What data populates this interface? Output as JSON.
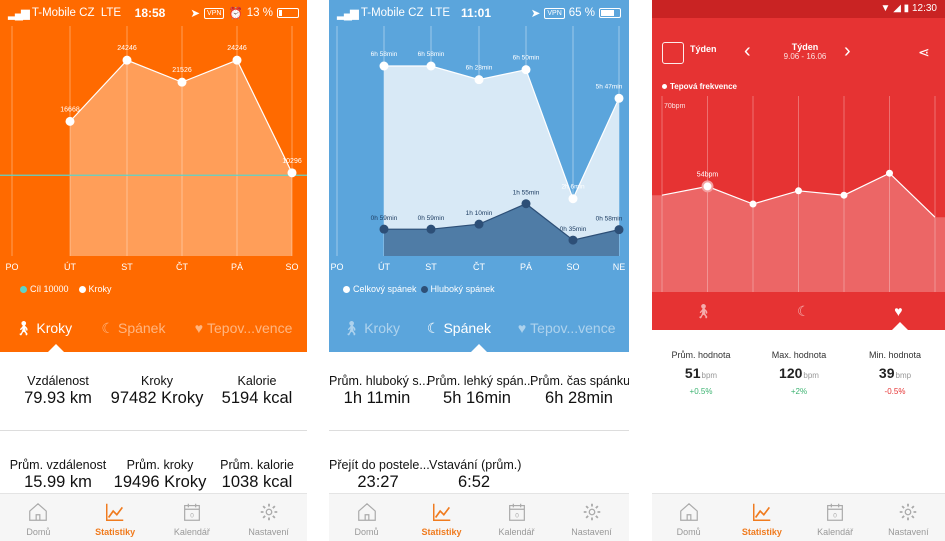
{
  "colors": {
    "orange": "#ff6a00",
    "blue": "#5ba5dc",
    "red": "#e63333",
    "nav_active": "#f07b1e"
  },
  "panel1": {
    "status": {
      "signal": "T-Mobile CZ",
      "net": "LTE",
      "time": "18:58",
      "vpn": "VPN",
      "battery": "13 %",
      "battery_level": 0.13
    },
    "x_labels": [
      "PO",
      "ÚT",
      "ST",
      "ČT",
      "PÁ",
      "SO"
    ],
    "points": [
      {
        "label": "16668",
        "value": 16668
      },
      {
        "label": "24246",
        "value": 24246
      },
      {
        "label": "21526",
        "value": 21526
      },
      {
        "label": "24246",
        "value": 24246
      },
      {
        "label": "10296",
        "value": 10296
      }
    ],
    "goal": 10000,
    "legend": {
      "goal": "Cíl 10000",
      "steps": "Kroky"
    },
    "tabs": {
      "steps": "Kroky",
      "sleep": "Spánek",
      "heart": "Tepov...vence"
    },
    "stats": [
      {
        "label": "Vzdálenost",
        "value": "79.93 km"
      },
      {
        "label": "Kroky",
        "value": "97482 Kroky"
      },
      {
        "label": "Kalorie",
        "value": "5194 kcal"
      },
      {
        "label": "Prům. vzdálenost",
        "value": "15.99 km"
      },
      {
        "label": "Prům. kroky",
        "value": "19496 Kroky"
      },
      {
        "label": "Prům. kalorie",
        "value": "1038 kcal"
      }
    ],
    "nav": [
      "Domů",
      "Statistiky",
      "Kalendář",
      "Nastavení"
    ]
  },
  "panel2": {
    "status": {
      "signal": "T-Mobile CZ",
      "net": "LTE",
      "time": "11:01",
      "vpn": "VPN",
      "battery": "65 %",
      "battery_level": 0.65
    },
    "x_labels": [
      "PO",
      "ÚT",
      "ST",
      "ČT",
      "PÁ",
      "SO",
      "NE"
    ],
    "total": [
      {
        "label": "6h 58min",
        "minutes": 418
      },
      {
        "label": "6h 58min",
        "minutes": 418
      },
      {
        "label": "6h 28min",
        "minutes": 388
      },
      {
        "label": "6h 50min",
        "minutes": 410
      },
      {
        "label": "2h 6min",
        "minutes": 126
      },
      {
        "label": "5h 47min",
        "minutes": 347
      }
    ],
    "deep": [
      {
        "label": "0h 59min",
        "minutes": 59
      },
      {
        "label": "0h 59min",
        "minutes": 59
      },
      {
        "label": "1h 10min",
        "minutes": 70
      },
      {
        "label": "1h 55min",
        "minutes": 115
      },
      {
        "label": "0h 35min",
        "minutes": 35
      },
      {
        "label": "0h 58min",
        "minutes": 58
      }
    ],
    "legend": {
      "total": "Celkový spánek",
      "deep": "Hluboký spánek"
    },
    "tabs": {
      "steps": "Kroky",
      "sleep": "Spánek",
      "heart": "Tepov...vence"
    },
    "stats": [
      {
        "label": "Prům. hluboký s...",
        "value": "1h  11min"
      },
      {
        "label": "Prům. lehký spán...",
        "value": "5h  16min"
      },
      {
        "label": "Prům. čas spánku",
        "value": "6h  28min"
      },
      {
        "label": "Přejít do postele...",
        "value": "23:27"
      },
      {
        "label": "Vstavání (prům.)",
        "value": "6:52"
      }
    ],
    "nav": [
      "Domů",
      "Statistiky",
      "Kalendář",
      "Nastavení"
    ]
  },
  "panel3": {
    "status": {
      "time": "12:30"
    },
    "header": {
      "calendar_label": "Týden",
      "title": "Týden",
      "range": "9.06 - 16.06"
    },
    "legend": "Tepová frekvence",
    "y_label": "70bpm",
    "peak_label": "54bpm",
    "values": [
      52,
      54,
      50,
      53,
      52,
      57,
      47
    ],
    "stats": [
      {
        "label": "Prům. hodnota",
        "value": "51",
        "unit": "bpm",
        "change": "+0.5%",
        "change_color": "#3cb371"
      },
      {
        "label": "Max. hodnota",
        "value": "120",
        "unit": "bpm",
        "change": "+2%",
        "change_color": "#3cb371"
      },
      {
        "label": "Min. hodnota",
        "value": "39",
        "unit": "bmp",
        "change": "-0.5%",
        "change_color": "#e63333"
      }
    ],
    "nav": [
      "Domů",
      "Statistiky",
      "Kalendář",
      "Nastavení"
    ]
  }
}
